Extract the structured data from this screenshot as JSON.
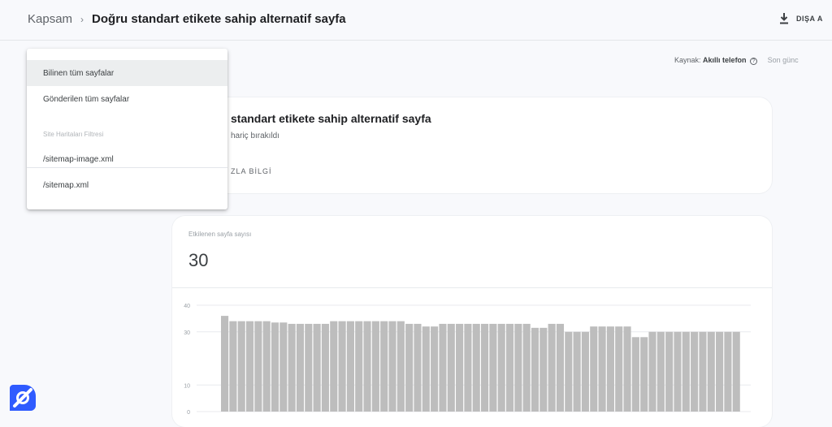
{
  "breadcrumb": {
    "root": "Kapsam",
    "separator": "›",
    "current": "Doğru standart etikete sahip alternatif sayfa"
  },
  "export": {
    "label": "DIŞA A",
    "icon": "download-icon"
  },
  "source": {
    "prefix": "Kaynak:",
    "value": "Akıllı telefon",
    "help_icon": "help-circle-icon",
    "last_updated": "Son günc"
  },
  "filter_menu": {
    "items": [
      {
        "label": "Bilinen tüm sayfalar",
        "selected": true
      },
      {
        "label": "Gönderilen tüm sayfalar",
        "selected": false
      }
    ],
    "group_label": "Site Haritaları Filtresi",
    "sitemaps": [
      "/sitemap-image.xml",
      "/sitemap.xml"
    ]
  },
  "info_card": {
    "title": "standart etikete sahip alternatif sayfa",
    "subtitle": "hariç bırakıldı",
    "more_link": "ZLA BİLGİ"
  },
  "chart_card": {
    "count_label": "Etkilenen sayfa sayısı",
    "count_value": "30"
  },
  "chart_data": {
    "type": "bar",
    "title": "",
    "xlabel": "",
    "ylabel": "",
    "ylim": [
      0,
      40
    ],
    "yticks": [
      "0",
      "10",
      "30",
      "40"
    ],
    "grid": true,
    "values": [
      36,
      34,
      34,
      34,
      34,
      34,
      33.5,
      33.5,
      33,
      33,
      33,
      33,
      33,
      34,
      34,
      34,
      34,
      34,
      34,
      34,
      34,
      34,
      33,
      33,
      32,
      32,
      33,
      33,
      33,
      33,
      33,
      33,
      33,
      33,
      33,
      33,
      33,
      31.5,
      31.5,
      33,
      33,
      30,
      30,
      30,
      32,
      32,
      32,
      32,
      32,
      28,
      28,
      30,
      30,
      30,
      30,
      30,
      30,
      30,
      30,
      30,
      30,
      30
    ],
    "bar_color": "#bdbdbd"
  },
  "colors": {
    "background": "#f8f9fc",
    "card": "#ffffff",
    "logo": "#2f5bff"
  }
}
